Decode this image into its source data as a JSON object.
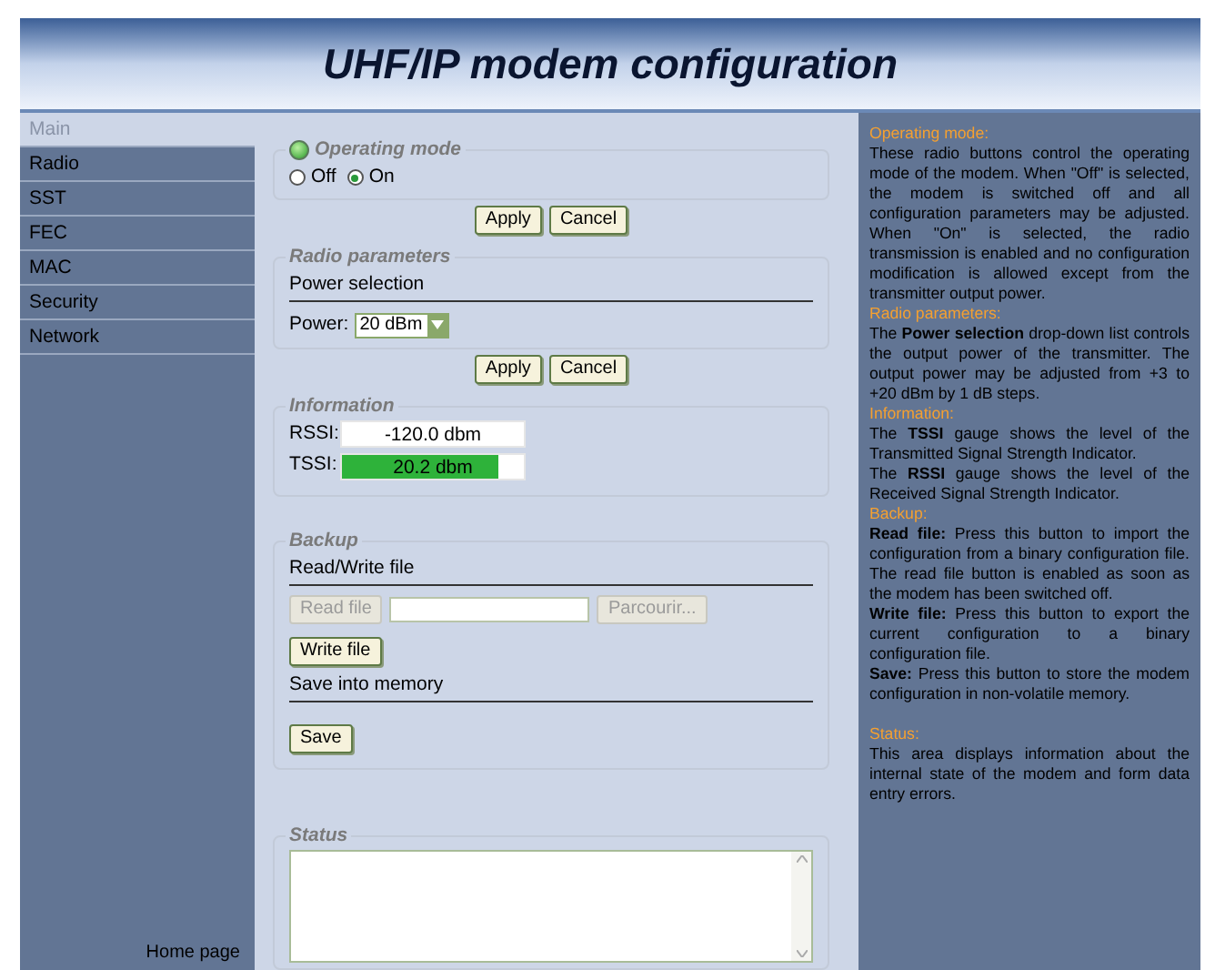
{
  "header": {
    "title": "UHF/IP modem configuration"
  },
  "sidebar": {
    "items": [
      {
        "label": "Main",
        "selected": true
      },
      {
        "label": "Radio",
        "selected": false
      },
      {
        "label": "SST",
        "selected": false
      },
      {
        "label": "FEC",
        "selected": false
      },
      {
        "label": "MAC",
        "selected": false
      },
      {
        "label": "Security",
        "selected": false
      },
      {
        "label": "Network",
        "selected": false
      }
    ],
    "footer_link": "Home page"
  },
  "operating_mode": {
    "legend": "Operating mode",
    "led_on": true,
    "options": [
      {
        "label": "Off",
        "selected": false
      },
      {
        "label": "On",
        "selected": true
      }
    ],
    "buttons": [
      "Apply",
      "Cancel"
    ]
  },
  "radio_parameters": {
    "legend": "Radio parameters",
    "section": "Power selection",
    "power_label": "Power:",
    "power_value": "20 dBm",
    "buttons": [
      "Apply",
      "Cancel"
    ]
  },
  "information": {
    "legend": "Information",
    "gauges": [
      {
        "label": "RSSI:",
        "reading": "-120.0 dbm"
      },
      {
        "label": "TSSI:",
        "reading": "20.2 dbm",
        "level": 0.86
      }
    ]
  },
  "backup": {
    "legend": "Backup",
    "file_section": "Read/Write file",
    "read_button": {
      "label": "Read file",
      "disabled": true
    },
    "browse_button": {
      "label": "Parcourir...",
      "disabled": true
    },
    "write_button": "Write file",
    "memory_section": "Save into memory",
    "save_button": "Save"
  },
  "status": {
    "legend": "Status"
  },
  "help": [
    {
      "heading": "Operating mode:",
      "paragraphs": [
        "These radio buttons control the operating mode of the modem. When \"Off\" is selected, the modem is switched off and all configuration parameters may be adjusted. When \"On\" is selected, the radio transmission is enabled and no configuration modification is allowed except from the transmitter output power."
      ]
    },
    {
      "heading": "Radio parameters:",
      "paragraphs": [
        "The **Power selection** drop-down list controls the output power of the transmitter. The output power may be adjusted from +3 to +20 dBm by 1 dB steps."
      ]
    },
    {
      "heading": "Information:",
      "paragraphs": [
        "The **TSSI** gauge shows the level of the Transmitted Signal Strength Indicator.",
        "The **RSSI** gauge shows the level of the Received Signal Strength Indicator."
      ]
    },
    {
      "heading": "Backup:",
      "paragraphs": [
        "**Read file:** Press this button to import the configuration from a binary configuration file. The read file button is enabled as soon as the modem has been switched off.",
        "**Write file:** Press this button to export the current configuration to a binary configuration file.",
        "**Save:** Press this button to store the modem configuration in non-volatile memory."
      ]
    },
    {
      "heading": "Status:",
      "gap": true,
      "paragraphs": [
        "This area displays information about the internal state of the modem and form data entry errors."
      ]
    }
  ]
}
